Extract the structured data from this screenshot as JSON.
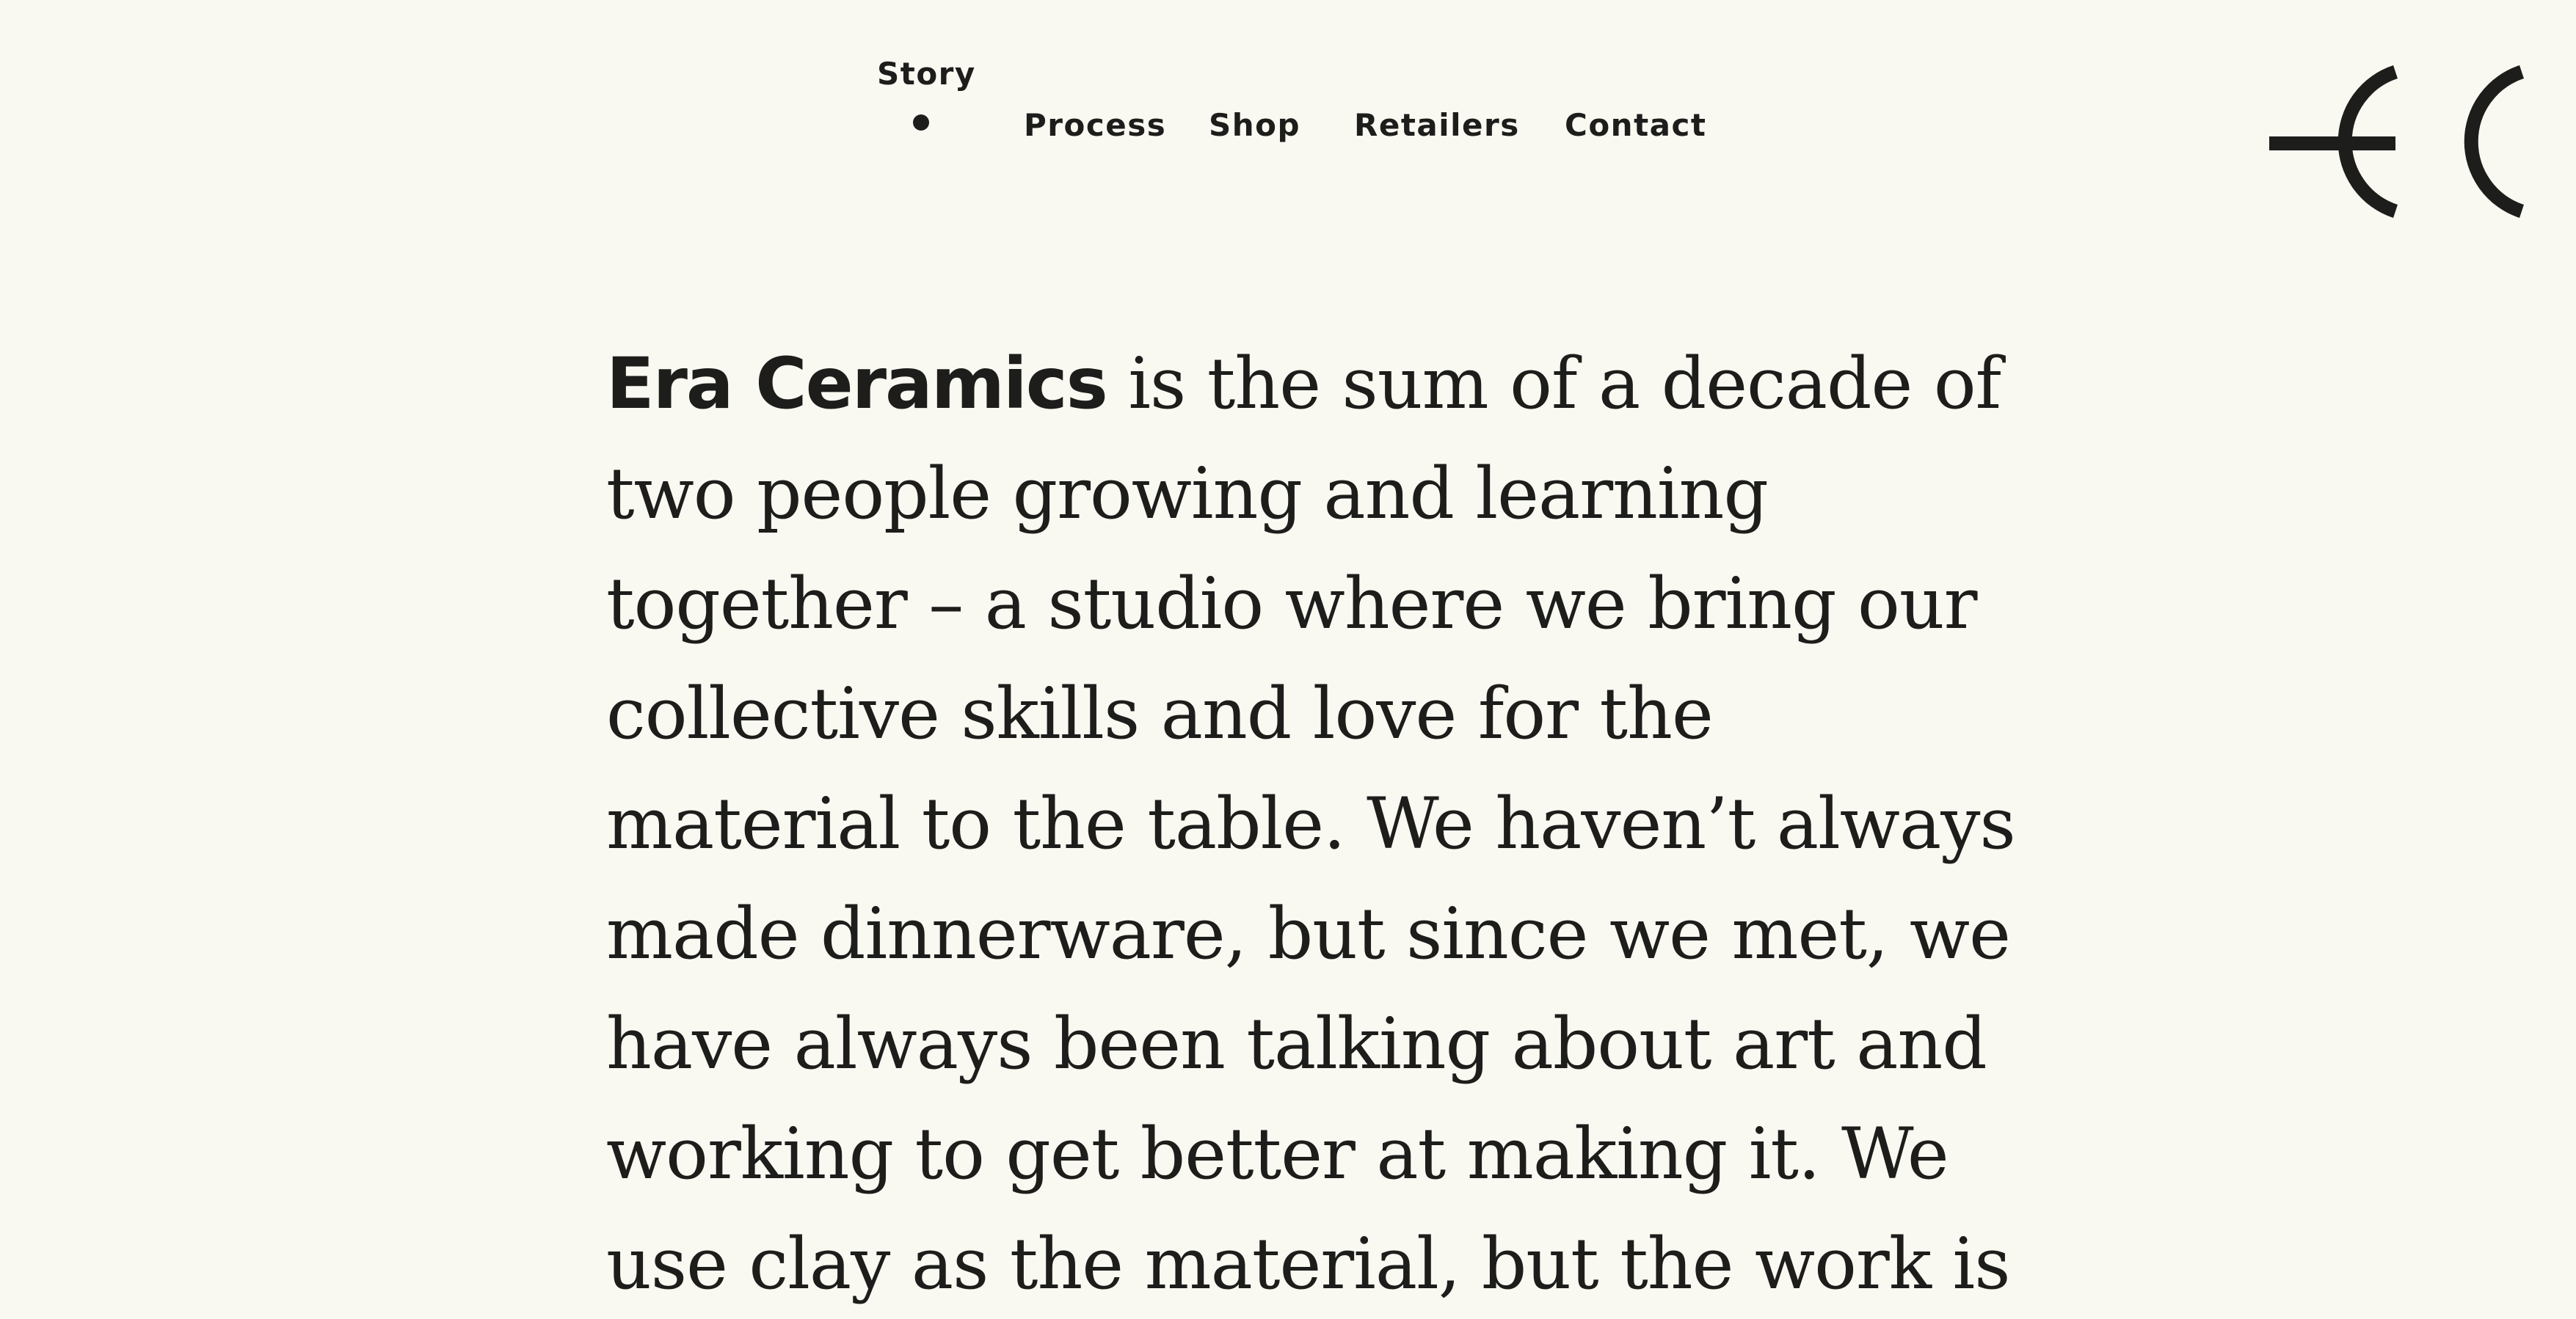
{
  "nav": {
    "items": [
      {
        "label": "Story",
        "active": true
      },
      {
        "label": "Process"
      },
      {
        "label": "Shop"
      },
      {
        "label": "Retailers"
      },
      {
        "label": "Contact"
      }
    ]
  },
  "logo": {
    "icon": "era-ceramics-monogram-icon"
  },
  "intro": {
    "brand": "Era Ceramics",
    "lines": [
      " is the sum of a decade of",
      "two people growing and learning",
      "together – a studio where we bring our",
      "collective skills and love for the",
      "material to the table. We haven’t always",
      "made dinnerware, but since we met, we",
      "have always been talking about art and",
      "working to get better at making it. We",
      "use clay as the material, but the work is"
    ]
  },
  "colors": {
    "background": "#f9f8f1",
    "text": "#1d1d1b"
  }
}
